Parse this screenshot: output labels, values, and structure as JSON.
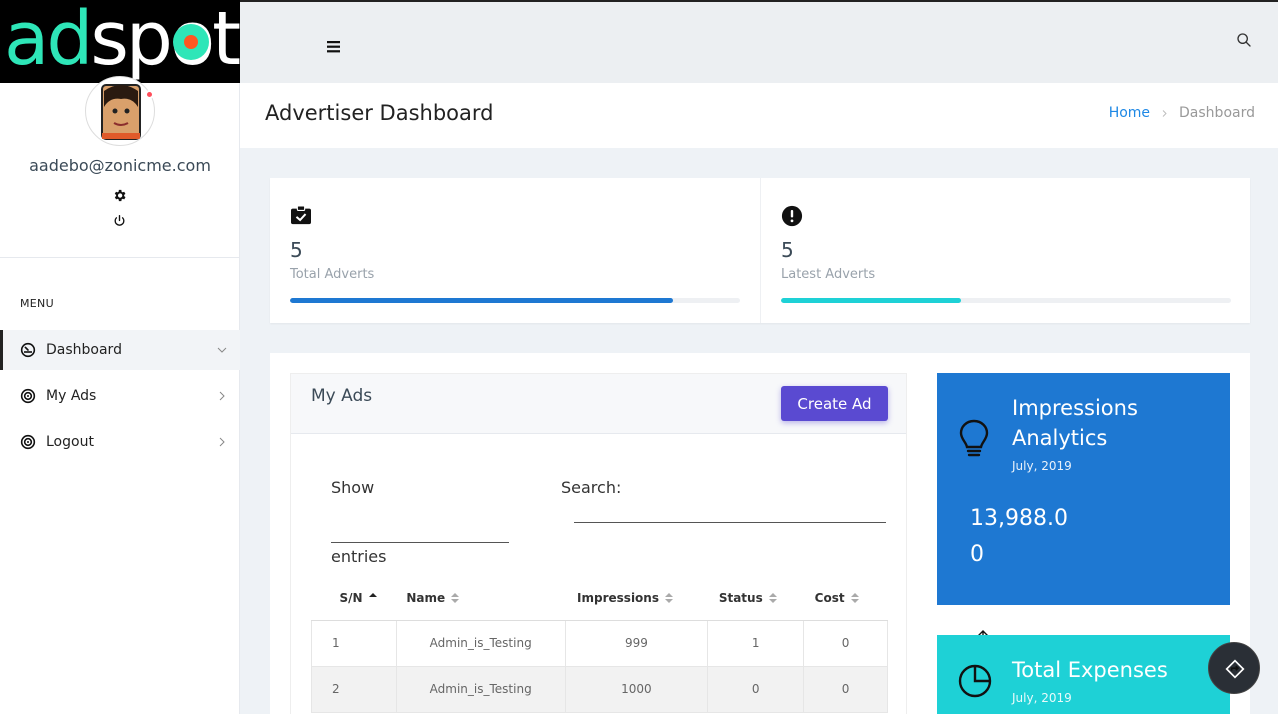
{
  "brand": {
    "logo_ad": "ad",
    "logo_spot": "spot"
  },
  "user": {
    "email": "aadebo@zonicme.com"
  },
  "sidebar": {
    "menu_label": "MENU",
    "items": [
      {
        "label": "Dashboard",
        "icon": "dashboard-gauge-icon",
        "active": true
      },
      {
        "label": "My Ads",
        "icon": "target-icon",
        "active": false
      },
      {
        "label": "Logout",
        "icon": "target-icon",
        "active": false
      }
    ]
  },
  "header": {
    "title": "Advertiser Dashboard",
    "breadcrumb": {
      "home": "Home",
      "current": "Dashboard"
    }
  },
  "stats": [
    {
      "value": "5",
      "label": "Total Adverts",
      "icon": "clipboard-check-icon",
      "progress": 0.85,
      "color": "#1e78d2"
    },
    {
      "value": "5",
      "label": "Latest Adverts",
      "icon": "alert-circle-icon",
      "progress": 0.4,
      "color": "#1ed1d6"
    }
  ],
  "my_ads": {
    "title": "My Ads",
    "create_label": "Create Ad",
    "show_label": "Show",
    "entries_label": "entries",
    "search_label": "Search:",
    "columns": [
      "S/N",
      "Name",
      "Impressions",
      "Status",
      "Cost"
    ],
    "rows": [
      [
        "1",
        "Admin_is_Testing",
        "999",
        "1",
        "0"
      ],
      [
        "2",
        "Admin_is_Testing",
        "1000",
        "0",
        "0"
      ]
    ]
  },
  "widgets": {
    "impressions": {
      "title": "Impressions Analytics",
      "date": "July, 2019",
      "value": "13,988.00"
    },
    "expenses": {
      "title": "Total Expenses",
      "date": "July, 2019"
    }
  },
  "colors": {
    "accent_purple": "#5a4ad1",
    "blue": "#1e78d2",
    "cyan": "#1ed1d6",
    "link": "#1e88e5"
  }
}
